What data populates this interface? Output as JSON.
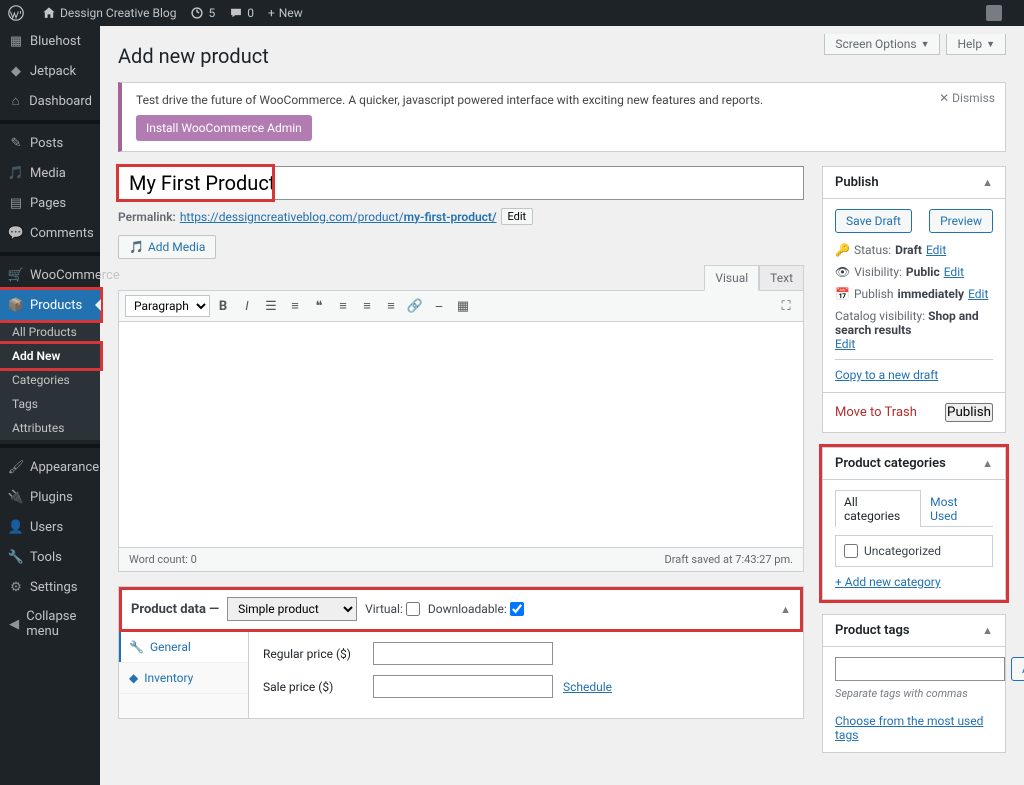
{
  "toolbar": {
    "site_name": "Dessign Creative Blog",
    "updates": "5",
    "comments": "0",
    "new": "New"
  },
  "sidebar": {
    "items": [
      {
        "label": "Bluehost",
        "icon": "grid"
      },
      {
        "label": "Jetpack",
        "icon": "jetpack"
      },
      {
        "label": "Dashboard",
        "icon": "dashboard"
      },
      {
        "label": "Posts",
        "icon": "pin"
      },
      {
        "label": "Media",
        "icon": "media"
      },
      {
        "label": "Pages",
        "icon": "page"
      },
      {
        "label": "Comments",
        "icon": "comment"
      },
      {
        "label": "WooCommerce",
        "icon": "woo"
      },
      {
        "label": "Products",
        "icon": "products",
        "current": true
      },
      {
        "label": "Appearance",
        "icon": "brush"
      },
      {
        "label": "Plugins",
        "icon": "plugin"
      },
      {
        "label": "Users",
        "icon": "users"
      },
      {
        "label": "Tools",
        "icon": "wrench"
      },
      {
        "label": "Settings",
        "icon": "sliders"
      },
      {
        "label": "Collapse menu",
        "icon": "collapse"
      }
    ],
    "products_submenu": [
      "All Products",
      "Add New",
      "Categories",
      "Tags",
      "Attributes"
    ]
  },
  "screen_options": "Screen Options",
  "help": "Help",
  "page_title": "Add new product",
  "notice": {
    "text": "Test drive the future of WooCommerce. A quicker, javascript powered interface with exciting new features and reports.",
    "button": "Install WooCommerce Admin",
    "dismiss": "Dismiss"
  },
  "title_value": "My First Product",
  "permalink": {
    "label": "Permalink:",
    "url_base": "https://dessigncreativeblog.com/product/",
    "slug": "my-first-product/",
    "edit": "Edit"
  },
  "add_media": "Add Media",
  "editor_tabs": {
    "visual": "Visual",
    "text": "Text"
  },
  "paragraph_label": "Paragraph",
  "word_count": "Word count: 0",
  "draft_saved": "Draft saved at 7:43:27 pm.",
  "publish": {
    "title": "Publish",
    "save_draft": "Save Draft",
    "preview": "Preview",
    "status_label": "Status:",
    "status_value": "Draft",
    "visibility_label": "Visibility:",
    "visibility_value": "Public",
    "publish_label": "Publish",
    "publish_value": "immediately",
    "catalog_label": "Catalog visibility:",
    "catalog_value": "Shop and search results",
    "edit": "Edit",
    "copy": "Copy to a new draft",
    "trash": "Move to Trash",
    "publish_btn": "Publish"
  },
  "categories": {
    "title": "Product categories",
    "tab_all": "All categories",
    "tab_most": "Most Used",
    "item": "Uncategorized",
    "add_new": "+ Add new category"
  },
  "tags": {
    "title": "Product tags",
    "add": "Add",
    "hint": "Separate tags with commas",
    "most_used": "Choose from the most used tags"
  },
  "product_data": {
    "title": "Product data",
    "dash": "—",
    "type_value": "Simple product",
    "virtual": "Virtual:",
    "downloadable": "Downloadable:",
    "tabs": [
      "General",
      "Inventory"
    ],
    "regular_price": "Regular price ($)",
    "sale_price": "Sale price ($)",
    "schedule": "Schedule"
  }
}
